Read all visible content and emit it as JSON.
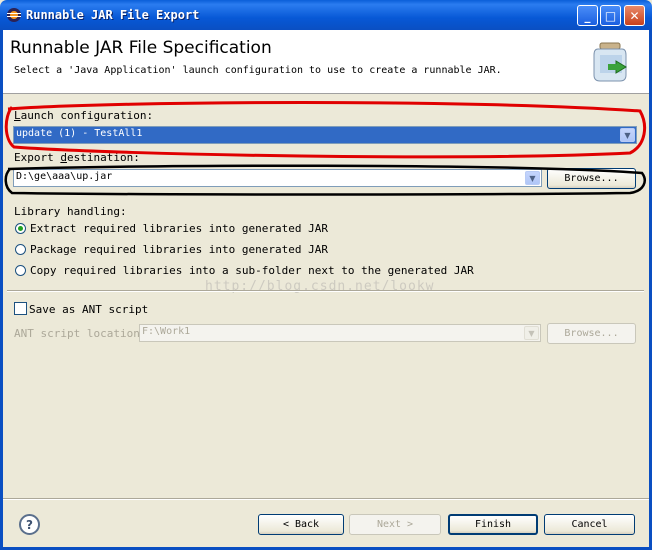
{
  "window": {
    "title": "Runnable JAR File Export"
  },
  "header": {
    "title": "Runnable JAR File Specification",
    "description": "Select a 'Java Application' launch configuration to use to create a runnable JAR."
  },
  "launch": {
    "label": "Launch configuration:",
    "value": "update (1) - TestAll1"
  },
  "export": {
    "label": "Export destination:",
    "value": "D:\\ge\\aaa\\up.jar",
    "browse": "Browse..."
  },
  "library": {
    "label": "Library handling:",
    "options": [
      {
        "label": "Extract required libraries into generated JAR",
        "selected": true
      },
      {
        "label": "Package required libraries into generated JAR",
        "selected": false
      },
      {
        "label": "Copy required libraries into a sub-folder next to the generated JAR",
        "selected": false
      }
    ]
  },
  "ant": {
    "save_label": "Save as ANT script",
    "checked": false,
    "location_label": "ANT script location:",
    "location_value": "F:\\Work1",
    "browse": "Browse..."
  },
  "watermark": "http://blog.csdn.net/lookw",
  "footer": {
    "back": "< Back",
    "next": "Next >",
    "finish": "Finish",
    "cancel": "Cancel"
  },
  "colors": {
    "annotation_red": "#e00000",
    "annotation_black": "#000000",
    "selection": "#316ac5"
  }
}
